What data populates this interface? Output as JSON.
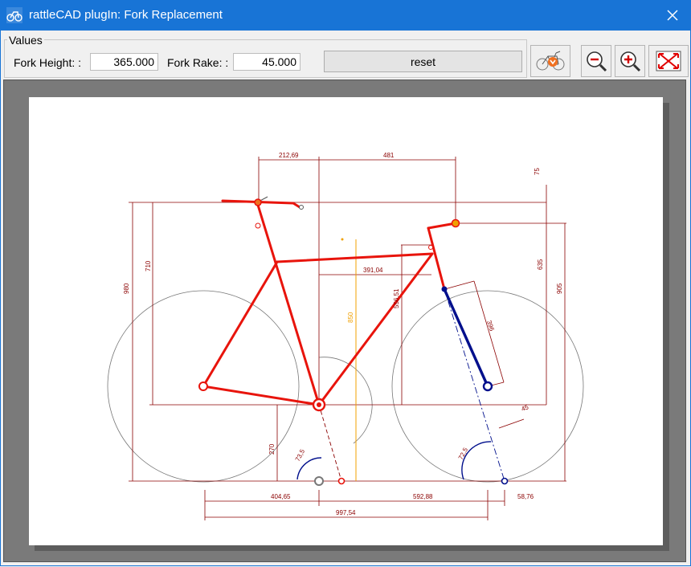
{
  "window": {
    "title": "rattleCAD plugIn: Fork Replacement",
    "close_label": "✕"
  },
  "values_group": {
    "legend": "Values",
    "fork_height_label": "Fork Height: :",
    "fork_height_value": "365.000",
    "fork_rake_label": "Fork Rake: :",
    "fork_rake_value": "45.000",
    "reset_label": "reset"
  },
  "toolbar": {
    "items": [
      {
        "name": "fork-tool-icon"
      },
      {
        "name": "zoom-out-icon"
      },
      {
        "name": "zoom-in-icon"
      },
      {
        "name": "fit-to-window-icon"
      }
    ]
  },
  "drawing": {
    "dimensions": {
      "d_212_69": "212,69",
      "d_481": "481",
      "d_75": "75",
      "d_980": "980",
      "d_710": "710",
      "d_635": "635",
      "d_905": "905",
      "d_391_04": "391,04",
      "d_556_51": "556,51",
      "d_850": "850",
      "d_396": "396",
      "d_45": "45",
      "d_270": "270",
      "d_73_5a": "73,5",
      "d_73_5b": "72,5",
      "d_404_65": "404,65",
      "d_592_88": "592,88",
      "d_58_76": "58,76",
      "d_997_54": "997,54"
    },
    "colors": {
      "frame": "#e8140c",
      "fork": "#000f8c",
      "dimension": "#8b0000",
      "highlight": "#f0a000"
    }
  }
}
